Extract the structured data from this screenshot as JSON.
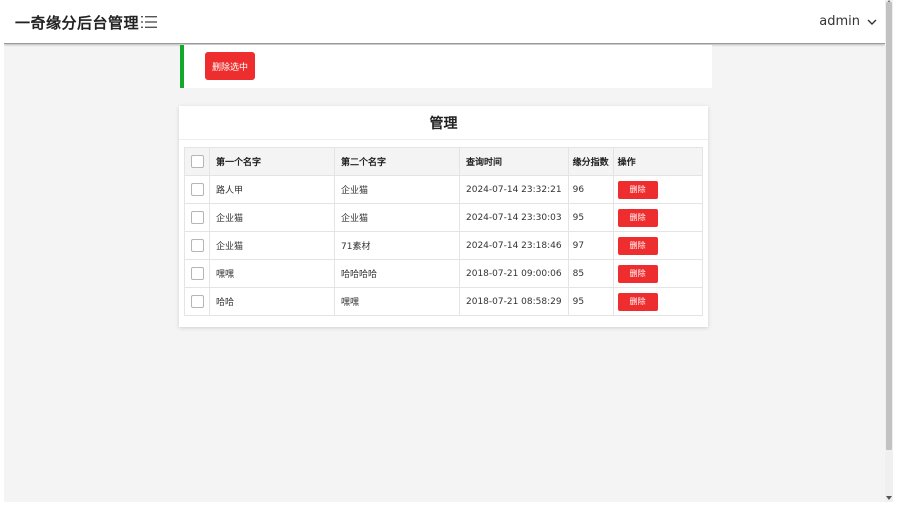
{
  "header": {
    "brand": "一奇缘分后台管理",
    "menu_icon": "menu-icon",
    "user_name": "admin",
    "user_chevron_icon": "chevron-down-icon"
  },
  "toolbar": {
    "delete_selected_label": "删除选中"
  },
  "panel": {
    "title": "管理",
    "columns": [
      "第一个名字",
      "第二个名字",
      "查询时间",
      "缘分指数",
      "操作"
    ],
    "rows": [
      {
        "name1": "路人甲",
        "name2": "企业猫",
        "time": "2024-07-14 23:32:21",
        "score": "96",
        "action": "删除"
      },
      {
        "name1": "企业猫",
        "name2": "企业猫",
        "time": "2024-07-14 23:30:03",
        "score": "95",
        "action": "删除"
      },
      {
        "name1": "企业猫",
        "name2": "71素材",
        "time": "2024-07-14 23:18:46",
        "score": "97",
        "action": "删除"
      },
      {
        "name1": "嘿嘿",
        "name2": "哈哈哈哈",
        "time": "2018-07-21 09:00:06",
        "score": "85",
        "action": "删除"
      },
      {
        "name1": "哈哈",
        "name2": "嘿嘿",
        "time": "2018-07-21 08:58:29",
        "score": "95",
        "action": "删除"
      }
    ]
  },
  "colors": {
    "danger": "#ee2e2e",
    "accent_green": "#14a72e",
    "background": "#f4f4f4"
  }
}
